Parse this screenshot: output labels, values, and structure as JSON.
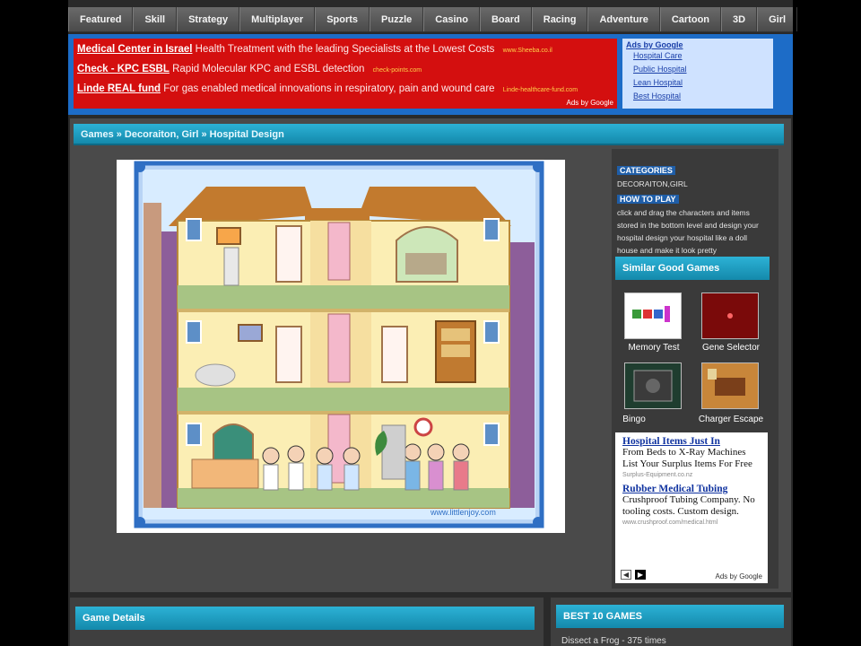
{
  "nav": [
    "Featured",
    "Skill",
    "Strategy",
    "Multiplayer",
    "Sports",
    "Puzzle",
    "Casino",
    "Board",
    "Racing",
    "Adventure",
    "Cartoon",
    "3D",
    "Girl"
  ],
  "ad_banner": {
    "lines": [
      {
        "title": "Medical Center in Israel",
        "text": "Health Treatment with the leading Specialists at the Lowest Costs",
        "url": "www.Sheeba.co.il"
      },
      {
        "title": "Check - KPC ESBL",
        "text": "Rapid Molecular KPC and ESBL detection",
        "url": "check-points.com"
      },
      {
        "title": "Linde REAL fund",
        "text": "For gas enabled medical innovations in respiratory, pain and wound care",
        "url": "Linde-healthcare-fund.com"
      }
    ],
    "ads_by_google": "Ads by Google",
    "right_title": "Ads by Google",
    "right_links": [
      "Hospital Care",
      "Public Hospital",
      "Lean Hospital",
      "Best Hospital"
    ]
  },
  "breadcrumb": "Games » Decoraiton, Girl » Hospital Design",
  "game": {
    "watermark": "www.littlenjoy.com"
  },
  "sidebar": {
    "categories_head": "CATEGORIES",
    "categories_value": "DECORAITON,GIRL",
    "howto_head": "HOW TO PLAY",
    "howto_lines": [
      "click and drag the characters and items",
      "stored in the bottom level and design your",
      "hospital design your hospital like a doll",
      "house and make it look pretty"
    ],
    "similar_title": "Similar Good Games",
    "similar": [
      {
        "label": "Memory Test"
      },
      {
        "label": "Gene Selector"
      },
      {
        "label": "Bingo"
      },
      {
        "label": "Charger Escape"
      }
    ],
    "ad": {
      "items": [
        {
          "title": "Hospital Items Just In",
          "body": "From Beds to X-Ray Machines List Your Surplus Items For Free",
          "url": "Surplus-Equipment.co.nz"
        },
        {
          "title": "Rubber Medical Tubing",
          "body": "Crushproof Tubing Company. No tooling costs. Custom design.",
          "url": "www.crushproof.com/medical.html"
        }
      ],
      "ads_by": "Ads by Google"
    }
  },
  "bottom": {
    "game_details": "Game Details",
    "best_games": "BEST 10 GAMES",
    "best_first": "Dissect a Frog - 375 times"
  }
}
